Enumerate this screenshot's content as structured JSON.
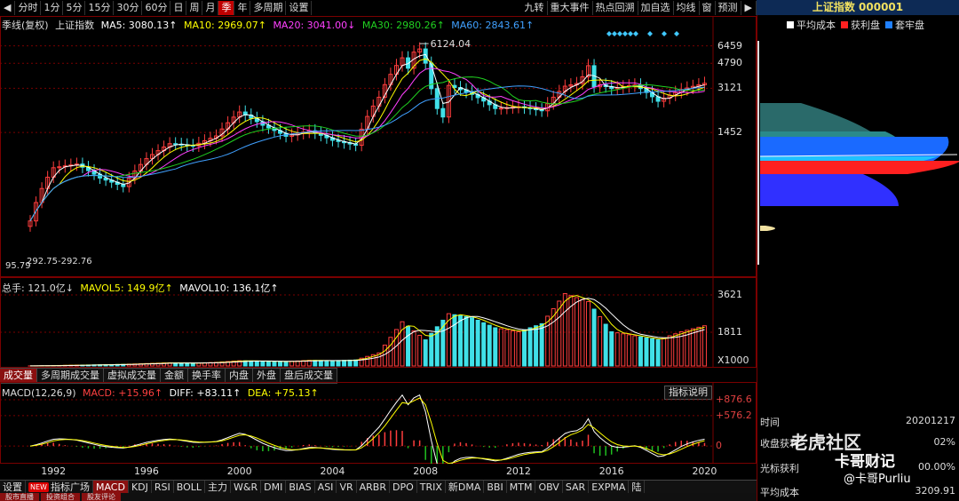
{
  "toolbar": {
    "items": [
      {
        "label": "分时",
        "active": false
      },
      {
        "label": "1分",
        "active": false
      },
      {
        "label": "5分",
        "active": false
      },
      {
        "label": "15分",
        "active": false
      },
      {
        "label": "30分",
        "active": false
      },
      {
        "label": "60分",
        "active": false
      },
      {
        "label": "日",
        "active": false
      },
      {
        "label": "周",
        "active": false
      },
      {
        "label": "月",
        "active": false
      },
      {
        "label": "季",
        "active": true
      },
      {
        "label": "年",
        "active": false
      },
      {
        "label": "多周期",
        "active": false
      },
      {
        "label": "设置",
        "active": false
      }
    ],
    "right_items": [
      "九转",
      "重大事件",
      "热点回溯",
      "加自选",
      "均线",
      "窗",
      "预测"
    ]
  },
  "main_legend": {
    "prefix": "季线(复权)",
    "index_name": "上证指数",
    "ma5": "MA5: 3080.13↑",
    "ma10": "MA10: 2969.07↑",
    "ma20": "MA20: 3041.00↓",
    "ma30": "MA30: 2980.26↑",
    "ma60": "MA60: 2843.61↑"
  },
  "colors": {
    "up": "#ff3d3d",
    "down": "#40e0e8",
    "ma5": "#ffffff",
    "ma10": "#ffff00",
    "ma20": "#ff40ff",
    "ma30": "#20d020",
    "ma60": "#40a0ff",
    "grid": "#7a0000"
  },
  "price_axis": [
    "6459",
    "4790",
    "3121",
    "1452"
  ],
  "price_annotations": {
    "high": "6124.04",
    "low": "95.79",
    "range": "292.75-292.76"
  },
  "volume_legend": {
    "total": "总手: 121.0亿↓",
    "mavol5": "MAVOL5: 149.9亿↑",
    "mavol10": "MAVOL10: 136.1亿↑"
  },
  "volume_axis": [
    "3621",
    "1811",
    "X1000"
  ],
  "volume_tabs": [
    {
      "label": "成交量",
      "active": true
    },
    {
      "label": "多周期成交量",
      "active": false
    },
    {
      "label": "虚拟成交量",
      "active": false
    },
    {
      "label": "金额",
      "active": false
    },
    {
      "label": "换手率",
      "active": false
    },
    {
      "label": "内盘",
      "active": false
    },
    {
      "label": "外盘",
      "active": false
    },
    {
      "label": "盘后成交量",
      "active": false
    }
  ],
  "macd_legend": {
    "name": "MACD(12,26,9)",
    "macd": "MACD: +15.96↑",
    "diff": "DIFF: +83.11↑",
    "dea": "DEA: +75.13↑",
    "help": "指标说明"
  },
  "macd_axis": [
    "+876.6",
    "+576.2",
    "0"
  ],
  "x_axis_years": [
    "1992",
    "1996",
    "2000",
    "2004",
    "2008",
    "2012",
    "2016",
    "2020"
  ],
  "indicator_bar": {
    "settings": "设置",
    "new_badge": "NEW",
    "items": [
      {
        "label": "指标广场",
        "active": false
      },
      {
        "label": "MACD",
        "active": true
      },
      {
        "label": "KDJ",
        "active": false
      },
      {
        "label": "RSI",
        "active": false
      },
      {
        "label": "BOLL",
        "active": false
      },
      {
        "label": "主力",
        "active": false
      },
      {
        "label": "W&R",
        "active": false
      },
      {
        "label": "DMI",
        "active": false
      },
      {
        "label": "BIAS",
        "active": false
      },
      {
        "label": "ASI",
        "active": false
      },
      {
        "label": "VR",
        "active": false
      },
      {
        "label": "ARBR",
        "active": false
      },
      {
        "label": "DPO",
        "active": false
      },
      {
        "label": "TRIX",
        "active": false
      },
      {
        "label": "新DMA",
        "active": false
      },
      {
        "label": "BBI",
        "active": false
      },
      {
        "label": "MTM",
        "active": false
      },
      {
        "label": "OBV",
        "active": false
      },
      {
        "label": "SAR",
        "active": false
      },
      {
        "label": "EXPMA",
        "active": false
      },
      {
        "label": "陆",
        "active": false
      }
    ]
  },
  "bottom_tabs": [
    "股市直播",
    "投资组合",
    "股友评论"
  ],
  "side": {
    "title": "上证指数 000001",
    "legend": [
      {
        "label": "平均成本",
        "color": "#ffffff"
      },
      {
        "label": "获利盘",
        "color": "#ff2020"
      },
      {
        "label": "套牢盘",
        "color": "#2080ff"
      }
    ],
    "rows": [
      {
        "label": "时间",
        "value": "20201217"
      },
      {
        "label": "收盘获利",
        "value": "02%"
      },
      {
        "label": "光标获利",
        "value": "00.00%"
      },
      {
        "label": "平均成本",
        "value": "3209.91"
      }
    ],
    "watermark": "老虎社区",
    "watermark_sub": "卡哥财记",
    "watermark_handle": "@卡哥Purliu"
  },
  "chart_data": {
    "type": "candlestick",
    "x": [
      1991,
      1992,
      1993,
      1994,
      1995,
      1996,
      1997,
      1998,
      1999,
      2000,
      2001,
      2002,
      2003,
      2004,
      2005,
      2006,
      2007,
      2008,
      2009,
      2010,
      2011,
      2012,
      2013,
      2014,
      2015,
      2016,
      2017,
      2018,
      2019,
      2020
    ],
    "close": [
      292,
      780,
      833,
      648,
      555,
      917,
      1194,
      1147,
      1367,
      2073,
      1646,
      1358,
      1497,
      1266,
      1161,
      2675,
      5262,
      1821,
      3277,
      2808,
      2199,
      2269,
      2116,
      3235,
      3539,
      3104,
      3307,
      2494,
      3050,
      3400
    ],
    "volume": [
      3,
      20,
      40,
      60,
      80,
      120,
      160,
      140,
      180,
      260,
      240,
      220,
      280,
      260,
      300,
      650,
      2200,
      1300,
      2600,
      2400,
      1900,
      1700,
      2100,
      3600,
      3200,
      1700,
      1500,
      1300,
      1700,
      2000
    ],
    "ylim_price": [
      95.79,
      6459
    ],
    "ylim_volume": [
      0,
      3621
    ],
    "ylim_macd": [
      -300,
      876.6
    ]
  }
}
